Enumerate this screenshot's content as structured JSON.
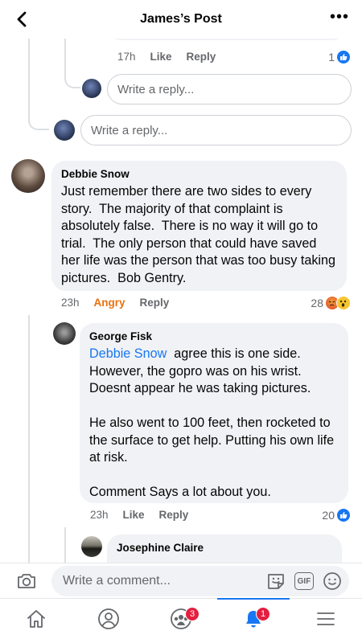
{
  "header": {
    "title": "James’s Post",
    "back_icon": "chevron-left-icon",
    "more_label": "•••"
  },
  "prev_reply": {
    "time": "17h",
    "like_label": "Like",
    "reply_label": "Reply",
    "reaction_count": "1"
  },
  "nested_reply_input": {
    "placeholder": "Write a reply..."
  },
  "thread_reply_input": {
    "placeholder": "Write a reply..."
  },
  "comments": [
    {
      "author": "Debbie Snow",
      "text": "Just remember there are two sides to every story.  The majority of that complaint is absolutely false.  There is no way it will go to trial.  The only person that could have saved her life was the person that was too busy taking pictures.  Bob Gentry.",
      "time": "23h",
      "reaction_label": "Angry",
      "reply_label": "Reply",
      "reaction_count": "28"
    },
    {
      "author": "George Fisk",
      "mention": "Debbie Snow",
      "text": "  agree this is one side. However, the gopro was on his wrist. Doesnt appear he was taking pictures.\n\nHe also went to 100 feet, then rocketed to the surface to get help. Putting his own life at risk.\n\nComment Says a lot about you.",
      "time": "23h",
      "like_label": "Like",
      "reply_label": "Reply",
      "reaction_count": "20"
    },
    {
      "author": "Josephine Claire"
    }
  ],
  "composer": {
    "placeholder": "Write a comment...",
    "gif_label": "GIF"
  },
  "bottom_nav": {
    "groups_badge": "3",
    "notifications_badge": "1"
  },
  "colors": {
    "link_blue": "#1877f2",
    "angry_orange": "#e9710f",
    "bubble_gray": "#f0f2f5",
    "badge_red": "#e41e3f"
  }
}
